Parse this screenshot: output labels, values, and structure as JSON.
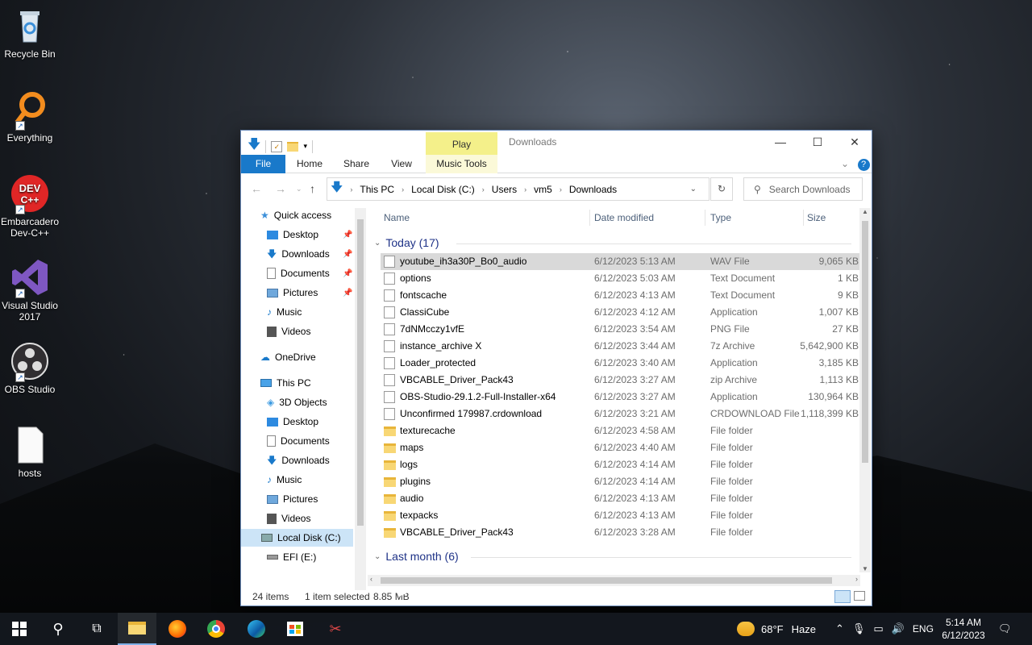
{
  "desktop": {
    "icons": [
      {
        "label": "Recycle Bin",
        "icon": "recycle-bin-icon"
      },
      {
        "label": "Everything",
        "icon": "everything-search-icon"
      },
      {
        "label": "Embarcadero Dev-C++",
        "icon": "devcpp-icon",
        "logo_text": "DEV C++"
      },
      {
        "label": "Visual Studio 2017",
        "icon": "visual-studio-icon"
      },
      {
        "label": "OBS Studio",
        "icon": "obs-icon"
      },
      {
        "label": "hosts",
        "icon": "file-icon"
      }
    ]
  },
  "window": {
    "title": "Downloads",
    "contextual_tab": "Play",
    "ribbon_tabs": [
      "File",
      "Home",
      "Share",
      "View",
      "Music Tools"
    ],
    "address": {
      "crumbs": [
        "This PC",
        "Local Disk (C:)",
        "Users",
        "vm5",
        "Downloads"
      ]
    },
    "search_placeholder": "Search Downloads",
    "nav": {
      "quick_access": "Quick access",
      "quick_items": [
        "Desktop",
        "Downloads",
        "Documents",
        "Pictures",
        "Music",
        "Videos"
      ],
      "onedrive": "OneDrive",
      "this_pc": "This PC",
      "pc_items": [
        "3D Objects",
        "Desktop",
        "Documents",
        "Downloads",
        "Music",
        "Pictures",
        "Videos",
        "Local Disk (C:)",
        "EFI (E:)"
      ]
    },
    "columns": {
      "name": "Name",
      "date": "Date modified",
      "type": "Type",
      "size": "Size"
    },
    "groups": [
      {
        "label": "Today (17)"
      },
      {
        "label": "Last month (6)"
      }
    ],
    "files": [
      {
        "name": "youtube_ih3a30P_Bo0_audio",
        "date": "6/12/2023 5:13 AM",
        "type": "WAV File",
        "size": "9,065 KB",
        "icon": "audio-file-icon",
        "selected": true
      },
      {
        "name": "options",
        "date": "6/12/2023 5:03 AM",
        "type": "Text Document",
        "size": "1 KB",
        "icon": "text-file-icon"
      },
      {
        "name": "fontscache",
        "date": "6/12/2023 4:13 AM",
        "type": "Text Document",
        "size": "9 KB",
        "icon": "text-file-icon"
      },
      {
        "name": "ClassiCube",
        "date": "6/12/2023 4:12 AM",
        "type": "Application",
        "size": "1,007 KB",
        "icon": "app-icon"
      },
      {
        "name": "7dNMcczy1vfE",
        "date": "6/12/2023 3:54 AM",
        "type": "PNG File",
        "size": "27 KB",
        "icon": "image-file-icon"
      },
      {
        "name": "instance_archive X",
        "date": "6/12/2023 3:44 AM",
        "type": "7z Archive",
        "size": "5,642,900 KB",
        "icon": "archive-icon"
      },
      {
        "name": "Loader_protected",
        "date": "6/12/2023 3:40 AM",
        "type": "Application",
        "size": "3,185 KB",
        "icon": "app-icon"
      },
      {
        "name": "VBCABLE_Driver_Pack43",
        "date": "6/12/2023 3:27 AM",
        "type": "zip Archive",
        "size": "1,113 KB",
        "icon": "archive-icon"
      },
      {
        "name": "OBS-Studio-29.1.2-Full-Installer-x64",
        "date": "6/12/2023 3:27 AM",
        "type": "Application",
        "size": "130,964 KB",
        "icon": "obs-icon"
      },
      {
        "name": "Unconfirmed 179987.crdownload",
        "date": "6/12/2023 3:21 AM",
        "type": "CRDOWNLOAD File",
        "size": "1,118,399 KB",
        "icon": "generic-file-icon"
      },
      {
        "name": "texturecache",
        "date": "6/12/2023 4:58 AM",
        "type": "File folder",
        "size": "",
        "icon": "folder-icon"
      },
      {
        "name": "maps",
        "date": "6/12/2023 4:40 AM",
        "type": "File folder",
        "size": "",
        "icon": "folder-icon"
      },
      {
        "name": "logs",
        "date": "6/12/2023 4:14 AM",
        "type": "File folder",
        "size": "",
        "icon": "folder-icon"
      },
      {
        "name": "plugins",
        "date": "6/12/2023 4:14 AM",
        "type": "File folder",
        "size": "",
        "icon": "folder-icon"
      },
      {
        "name": "audio",
        "date": "6/12/2023 4:13 AM",
        "type": "File folder",
        "size": "",
        "icon": "folder-icon"
      },
      {
        "name": "texpacks",
        "date": "6/12/2023 4:13 AM",
        "type": "File folder",
        "size": "",
        "icon": "folder-icon"
      },
      {
        "name": "VBCABLE_Driver_Pack43",
        "date": "6/12/2023 3:28 AM",
        "type": "File folder",
        "size": "",
        "icon": "folder-icon"
      }
    ],
    "status": {
      "count": "24 items",
      "selected": "1 item selected",
      "size": "8.85 MB"
    }
  },
  "taskbar": {
    "weather": {
      "temp": "68°F",
      "cond": "Haze"
    },
    "lang": "ENG",
    "time": "5:14 AM",
    "date": "6/12/2023"
  },
  "colors": {
    "accent": "#1979ca",
    "context_tab": "#f4f08a",
    "selection": "#cce4f7"
  }
}
